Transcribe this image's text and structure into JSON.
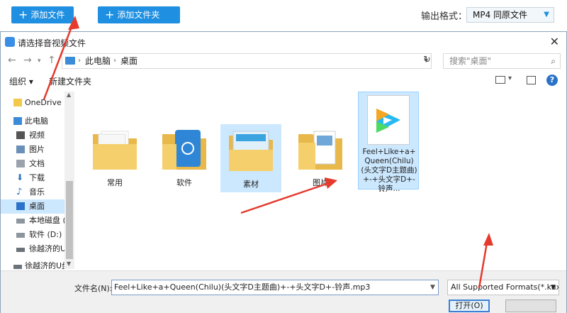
{
  "app_bar": {
    "add_file_label": "添加文件",
    "add_folder_label": "添加文件夹",
    "output_format_label": "输出格式：",
    "output_format_value": "MP4  同原文件"
  },
  "dialog": {
    "title": "请选择音视频文件",
    "address": {
      "crumbs": [
        "此电脑",
        "桌面"
      ]
    },
    "search_placeholder": "搜索\"桌面\"",
    "toolbar": {
      "organize": "组织 ▾",
      "new_folder": "新建文件夹"
    },
    "sidebar": [
      {
        "label": "OneDrive",
        "icon": "folder-icon",
        "root": true
      },
      {
        "label": "此电脑",
        "icon": "computer-icon",
        "root": true
      },
      {
        "label": "视频",
        "icon": "video-icon"
      },
      {
        "label": "图片",
        "icon": "picture-icon"
      },
      {
        "label": "文档",
        "icon": "document-icon"
      },
      {
        "label": "下载",
        "icon": "download-icon"
      },
      {
        "label": "音乐",
        "icon": "music-icon"
      },
      {
        "label": "桌面",
        "icon": "desktop-icon",
        "selected": true
      },
      {
        "label": "本地磁盘 (",
        "icon": "drive-icon"
      },
      {
        "label": "软件 (D:)",
        "icon": "drive-icon"
      },
      {
        "label": "徐越济的U",
        "icon": "usb-icon"
      },
      {
        "label": "徐越济的U盘",
        "icon": "usb-icon",
        "root": true
      }
    ],
    "files": [
      {
        "name": "常用",
        "type": "folder"
      },
      {
        "name": "软件",
        "type": "folder"
      },
      {
        "name": "素材",
        "type": "folder",
        "selected": true
      },
      {
        "name": "图片",
        "type": "folder"
      }
    ],
    "mp3_file": {
      "name": "Feel+Like+a+Queen(Chilu)(头文字D主题曲)+-+头文字D+-铃声..."
    },
    "filename_label": "文件名(N):",
    "filename_value": "Feel+Like+a+Queen(Chilu)(头文字D主题曲)+-+头文字D+-铃声.mp3",
    "filter_value": "All Supported Formats(*.kux",
    "open_label": "打开(O)"
  },
  "colors": {
    "accent": "#1e8fe1",
    "selection": "#cce8ff",
    "arrow": "#e53a2e"
  }
}
